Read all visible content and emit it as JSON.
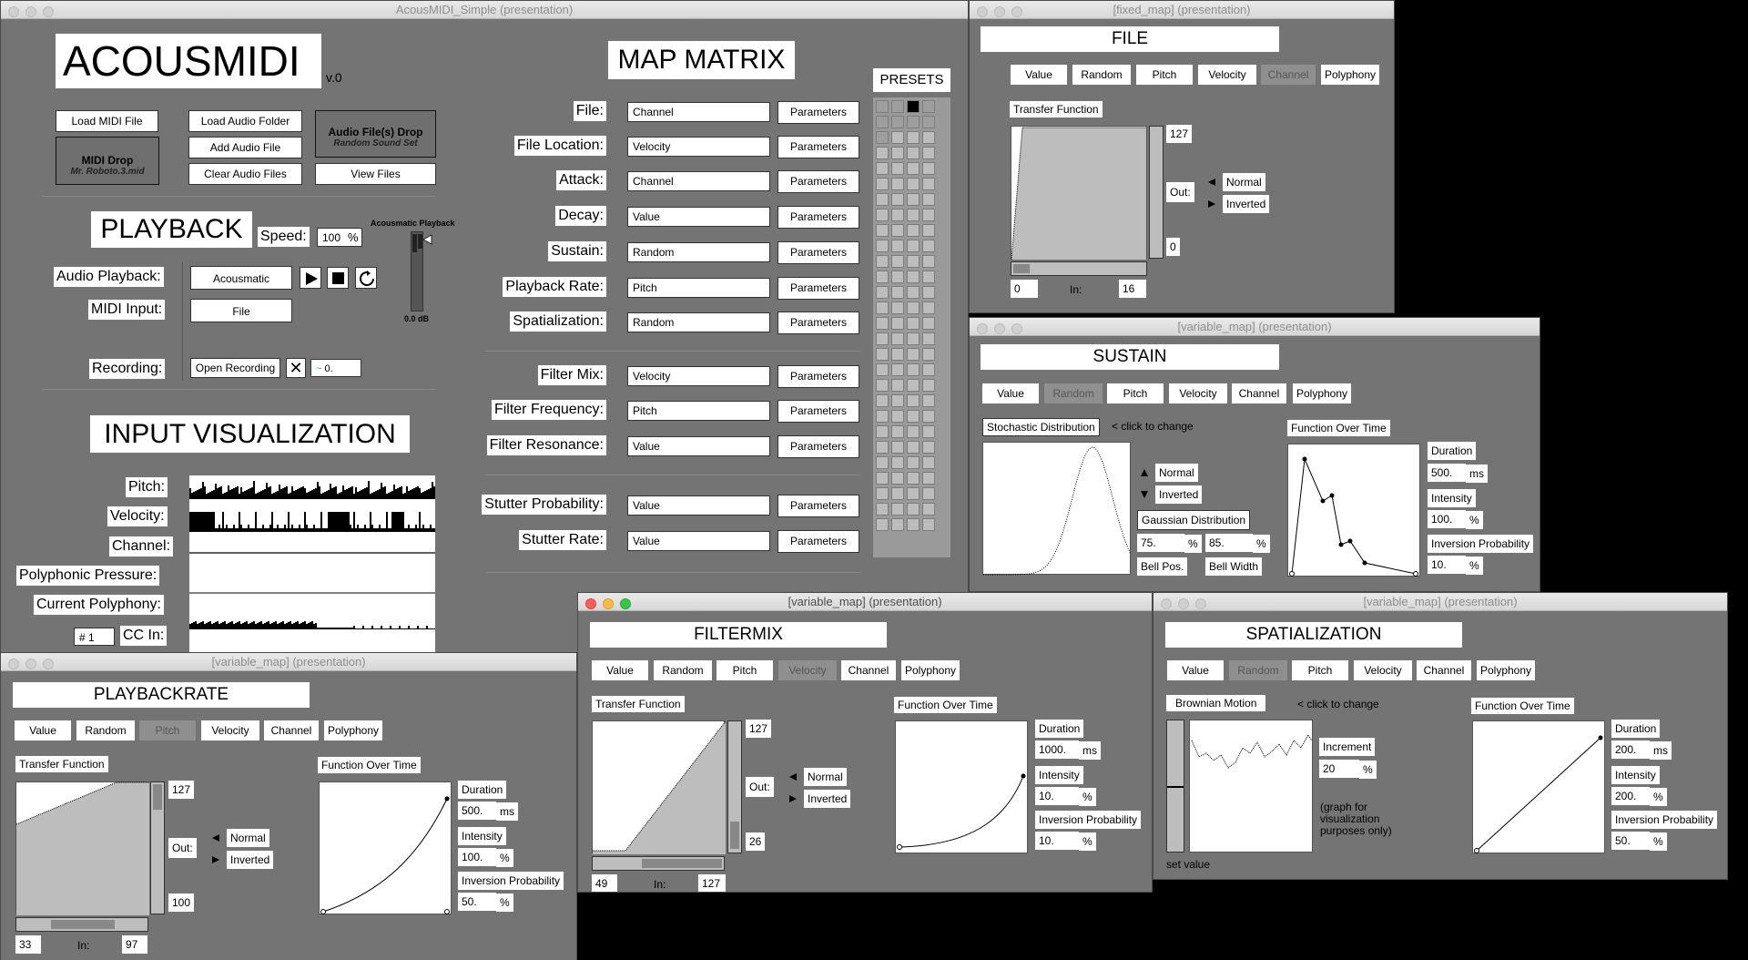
{
  "main": {
    "title": "AcousMIDI_Simple (presentation)",
    "app_name": "ACOUSMIDI",
    "version": "v.0",
    "load_midi": "Load MIDI File",
    "load_audio_folder": "Load Audio Folder",
    "add_audio_file": "Add Audio File",
    "clear_audio": "Clear Audio Files",
    "view_files": "View Files",
    "midi_drop": "MIDI Drop",
    "midi_drop_file": "Mr. Roboto.3.mid",
    "audio_drop": "Audio File(s) Drop",
    "audio_drop_sub": "Random Sound Set",
    "playback_title": "PLAYBACK",
    "speed_label": "Speed:",
    "speed_value": "100",
    "speed_unit": "%",
    "meter_label": "Acousmatic Playback",
    "meter_db": "0.0 dB",
    "audio_playback_label": "Audio Playback:",
    "audio_playback_value": "Acousmatic",
    "midi_input_label": "MIDI Input:",
    "midi_input_value": "File",
    "recording_label": "Recording:",
    "open_recording": "Open Recording",
    "rec_value": "0.",
    "viz_title": "INPUT VISUALIZATION",
    "viz_labels": [
      "Pitch:",
      "Velocity:",
      "Channel:",
      "Polyphonic Pressure:",
      "Current Polyphony:"
    ],
    "cc_num": "# 1",
    "cc_label": "CC In:",
    "map_title": "MAP MATRIX",
    "presets_label": "PRESETS",
    "params_label": "Parameters",
    "map_rows": [
      {
        "label": "File:",
        "value": "Channel"
      },
      {
        "label": "File Location:",
        "value": "Velocity"
      },
      {
        "label": "Attack:",
        "value": "Channel"
      },
      {
        "label": "Decay:",
        "value": "Value"
      },
      {
        "label": "Sustain:",
        "value": "Random"
      },
      {
        "label": "Playback Rate:",
        "value": "Pitch"
      },
      {
        "label": "Spatialization:",
        "value": "Random"
      },
      {
        "label": "Filter Mix:",
        "value": "Velocity"
      },
      {
        "label": "Filter Frequency:",
        "value": "Pitch"
      },
      {
        "label": "Filter Resonance:",
        "value": "Value"
      },
      {
        "label": "Stutter Probability:",
        "value": "Value"
      },
      {
        "label": "Stutter Rate:",
        "value": "Value"
      }
    ]
  },
  "tabs": [
    "Value",
    "Random",
    "Pitch",
    "Velocity",
    "Channel",
    "Polyphony"
  ],
  "common": {
    "transfer": "Transfer Function",
    "out": "Out:",
    "in": "In:",
    "normal": "Normal",
    "inverted": "Inverted",
    "fot": "Function Over Time",
    "duration": "Duration",
    "intensity": "Intensity",
    "inv_prob": "Inversion Probability",
    "ms": "ms",
    "pct": "%",
    "click": "< click to change"
  },
  "file_win": {
    "title": "[fixed_map] (presentation)",
    "header": "FILE",
    "out_max": "127",
    "out_min": "0",
    "in_min": "0",
    "in_max": "16"
  },
  "sustain_win": {
    "title": "[variable_map] (presentation)",
    "header": "SUSTAIN",
    "dist": "Stochastic Distribution",
    "gauss": "Gaussian Distribution",
    "bell_pos": "75.",
    "bell_width": "85.",
    "bell_pos_label": "Bell Pos.",
    "bell_width_label": "Bell Width",
    "duration": "500.",
    "intensity": "100.",
    "inv": "10."
  },
  "playbackrate_win": {
    "title": "[variable_map] (presentation)",
    "header": "PLAYBACKRATE",
    "out_max": "127",
    "out_min": "100",
    "in_min": "33",
    "in_max": "97",
    "duration": "500.",
    "intensity": "100.",
    "inv": "50."
  },
  "filtermix_win": {
    "title": "[variable_map] (presentation)",
    "header": "FILTERMIX",
    "out_max": "127",
    "out_min": "26",
    "in_min": "49",
    "in_max": "127",
    "duration": "1000.",
    "intensity": "10.",
    "inv": "10."
  },
  "spatial_win": {
    "title": "[variable_map] (presentation)",
    "header": "SPATIALIZATION",
    "motion": "Brownian Motion",
    "increment_label": "Increment",
    "increment": "20",
    "note": "(graph for visualization purposes only)",
    "set_value": "set value",
    "duration": "200.",
    "intensity": "200.",
    "inv": "50."
  },
  "colors": {
    "panel": "#747474",
    "close": "#fc605b",
    "min": "#fdbc40",
    "max": "#34c84a"
  }
}
